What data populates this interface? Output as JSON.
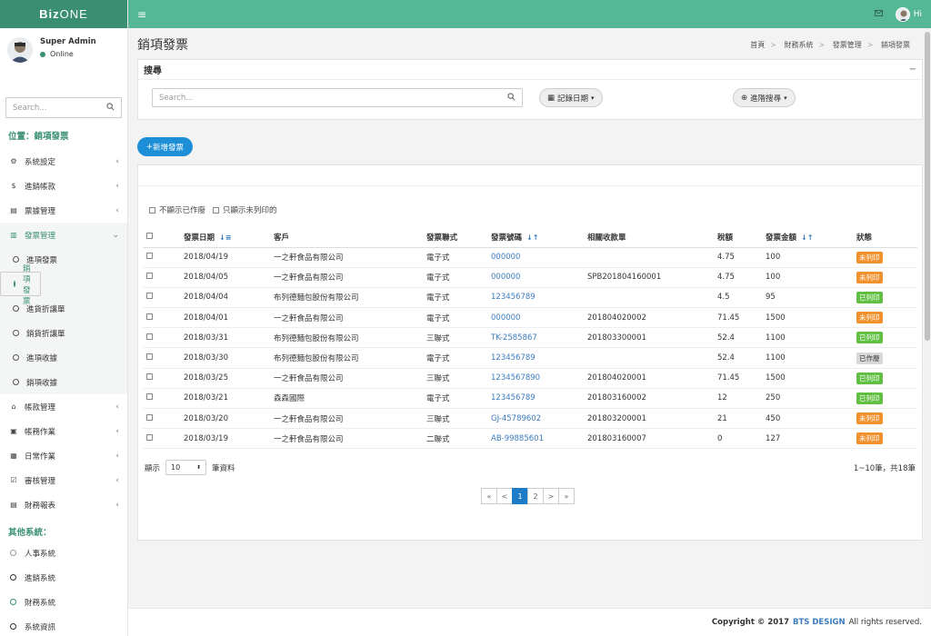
{
  "brand": {
    "bold": "Biz",
    "light": "ONE"
  },
  "topbar": {
    "greeting": "Hi"
  },
  "user": {
    "name": "Super Admin",
    "status": "Online"
  },
  "sidebar": {
    "search_placeholder": "Search...",
    "location": "位置：銷項發票",
    "menu": [
      {
        "label": "系統設定"
      },
      {
        "label": "進銷帳款"
      },
      {
        "label": "票據管理"
      },
      {
        "label": "發票管理"
      }
    ],
    "submenu": [
      {
        "label": "進項發票"
      },
      {
        "label": "銷項發票"
      },
      {
        "label": "進貨折讓單"
      },
      {
        "label": "銷貨折讓單"
      },
      {
        "label": "進項收據"
      },
      {
        "label": "銷項收據"
      }
    ],
    "menu2": [
      {
        "label": "帳款管理"
      },
      {
        "label": "帳務作業"
      },
      {
        "label": "日常作業"
      },
      {
        "label": "審核管理"
      },
      {
        "label": "財務報表"
      }
    ],
    "other_title": "其他系統：",
    "other": [
      {
        "label": "人事系統"
      },
      {
        "label": "進銷系統"
      },
      {
        "label": "財務系統"
      },
      {
        "label": "系統資訊"
      }
    ]
  },
  "page": {
    "title": "銷項發票",
    "breadcrumb": [
      "首頁",
      "財務系統",
      "發票管理",
      "銷項發票"
    ]
  },
  "search_box": {
    "title": "搜尋",
    "placeholder": "Search...",
    "date_btn": "記錄日期",
    "adv_btn": "進階搜尋"
  },
  "add_button": "新增發票",
  "filters": {
    "hide_void": "不顯示已作廢",
    "only_unprinted": "只顯示未列印的"
  },
  "table": {
    "headers": [
      "發票日期",
      "客戶",
      "發票聯式",
      "發票號碼",
      "相關收款單",
      "稅額",
      "發票金額",
      "狀態"
    ],
    "rows": [
      {
        "date": "2018/04/19",
        "customer": "一之軒食品有限公司",
        "form": "電子式",
        "no": "000000",
        "receipt": "",
        "tax": "4.75",
        "amount": "100",
        "status": "未列印"
      },
      {
        "date": "2018/04/05",
        "customer": "一之軒食品有限公司",
        "form": "電子式",
        "no": "000000",
        "receipt": "SPB201804160001",
        "tax": "4.75",
        "amount": "100",
        "status": "未列印"
      },
      {
        "date": "2018/04/04",
        "customer": "布列德麵包股份有限公司",
        "form": "電子式",
        "no": "123456789",
        "receipt": "",
        "tax": "4.5",
        "amount": "95",
        "status": "已列印"
      },
      {
        "date": "2018/04/01",
        "customer": "一之軒食品有限公司",
        "form": "電子式",
        "no": "000000",
        "receipt": "201804020002",
        "tax": "71.45",
        "amount": "1500",
        "status": "未列印"
      },
      {
        "date": "2018/03/31",
        "customer": "布列德麵包股份有限公司",
        "form": "三聯式",
        "no": "TK-2585867",
        "receipt": "201803300001",
        "tax": "52.4",
        "amount": "1100",
        "status": "已列印"
      },
      {
        "date": "2018/03/30",
        "customer": "布列德麵包股份有限公司",
        "form": "電子式",
        "no": "123456789",
        "receipt": "",
        "tax": "52.4",
        "amount": "1100",
        "status": "已作廢"
      },
      {
        "date": "2018/03/25",
        "customer": "一之軒食品有限公司",
        "form": "三聯式",
        "no": "1234567890",
        "receipt": "201804020001",
        "tax": "71.45",
        "amount": "1500",
        "status": "已列印"
      },
      {
        "date": "2018/03/21",
        "customer": "森森國際",
        "form": "電子式",
        "no": "123456789",
        "receipt": "201803160002",
        "tax": "12",
        "amount": "250",
        "status": "已列印"
      },
      {
        "date": "2018/03/20",
        "customer": "一之軒食品有限公司",
        "form": "三聯式",
        "no": "GJ-45789602",
        "receipt": "201803200001",
        "tax": "21",
        "amount": "450",
        "status": "未列印"
      },
      {
        "date": "2018/03/19",
        "customer": "一之軒食品有限公司",
        "form": "二聯式",
        "no": "AB-99885601",
        "receipt": "201803160007",
        "tax": "0",
        "amount": "127",
        "status": "未列印"
      }
    ]
  },
  "pager": {
    "show": "顯示",
    "per_page": "10",
    "records": "筆資料",
    "summary": "1~10筆，共18筆",
    "pages": [
      "«",
      "<",
      "1",
      "2",
      ">",
      "»"
    ],
    "current": "1"
  },
  "footer": {
    "copyright": "Copyright © 2017",
    "company": "BTS DESIGN",
    "rights": "All rights reserved."
  },
  "colors": {
    "accent": "#3a8f72",
    "topbar": "#55b795",
    "link": "#3b7bbf",
    "unprinted": "#f0912d",
    "printed": "#61c042",
    "void": "#d8d8d8"
  }
}
